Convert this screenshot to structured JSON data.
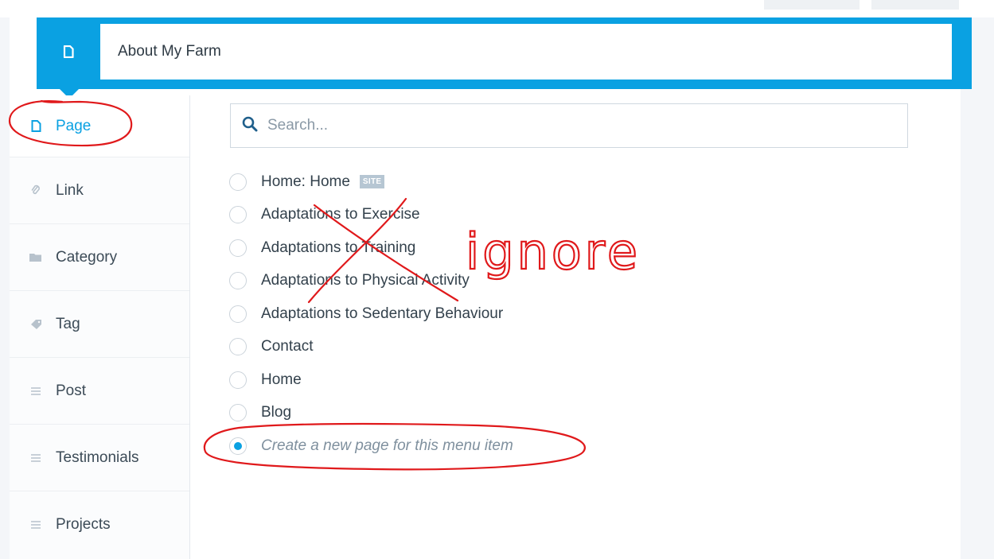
{
  "header": {
    "title_value": "About My Farm",
    "type_icon": "page-icon",
    "accent_color": "#0aa1e2"
  },
  "sidebar": {
    "items": [
      {
        "label": "Page",
        "icon": "page-icon",
        "active": true
      },
      {
        "label": "Link",
        "icon": "link-icon",
        "active": false
      },
      {
        "label": "Category",
        "icon": "folder-icon",
        "active": false
      },
      {
        "label": "Tag",
        "icon": "tag-icon",
        "active": false
      },
      {
        "label": "Post",
        "icon": "lines-icon",
        "active": false
      },
      {
        "label": "Testimonials",
        "icon": "lines-icon",
        "active": false
      },
      {
        "label": "Projects",
        "icon": "lines-icon",
        "active": false
      }
    ]
  },
  "search": {
    "placeholder": "Search...",
    "value": ""
  },
  "pages": [
    {
      "label": "Home: Home",
      "badge": "SITE",
      "selected": false
    },
    {
      "label": "Adaptations to Exercise",
      "selected": false
    },
    {
      "label": "Adaptations to Training",
      "selected": false
    },
    {
      "label": "Adaptations to Physical Activity",
      "selected": false
    },
    {
      "label": "Adaptations to Sedentary Behaviour",
      "selected": false
    },
    {
      "label": "Contact",
      "selected": false
    },
    {
      "label": "Home",
      "selected": false
    },
    {
      "label": "Blog",
      "selected": false
    },
    {
      "label": "Create a new page for this menu item",
      "selected": true,
      "italic": true
    }
  ],
  "annotation": {
    "text": "ignore",
    "color": "#e0191b"
  }
}
